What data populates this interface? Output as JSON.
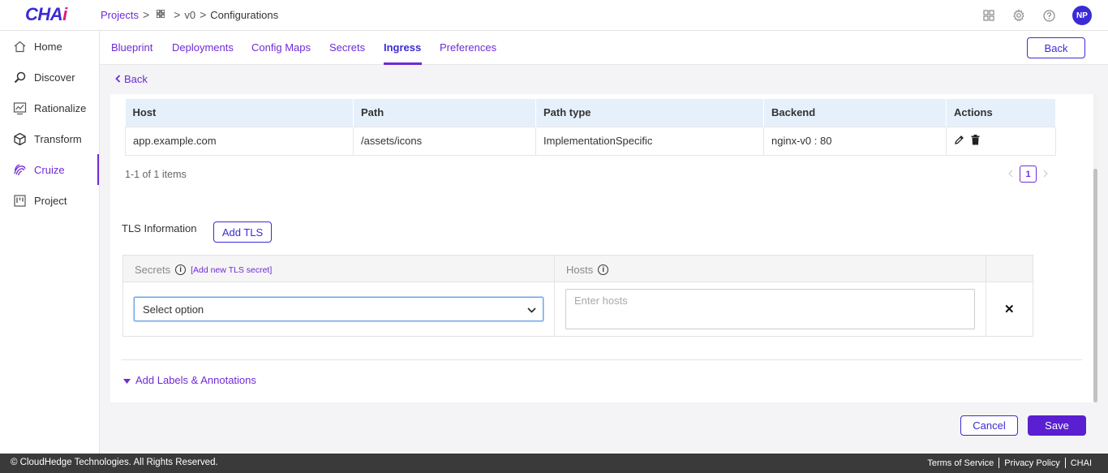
{
  "app": {
    "logo_main": "CHA",
    "logo_accent": "i"
  },
  "breadcrumb": {
    "projects": "Projects",
    "version": "v0",
    "current": "Configurations",
    "separator": ">"
  },
  "topbar": {
    "avatar_initials": "NP"
  },
  "sidebar": {
    "items": [
      {
        "label": "Home",
        "icon": "home-icon"
      },
      {
        "label": "Discover",
        "icon": "discover-icon"
      },
      {
        "label": "Rationalize",
        "icon": "rationalize-icon"
      },
      {
        "label": "Transform",
        "icon": "transform-icon"
      },
      {
        "label": "Cruize",
        "icon": "cruize-icon",
        "active": true
      },
      {
        "label": "Project",
        "icon": "project-icon"
      }
    ]
  },
  "tabs": [
    "Blueprint",
    "Deployments",
    "Config Maps",
    "Secrets",
    "Ingress",
    "Preferences"
  ],
  "active_tab": "Ingress",
  "header": {
    "back_button": "Back"
  },
  "back_link": "Back",
  "ingress_table": {
    "columns": [
      "Host",
      "Path",
      "Path type",
      "Backend",
      "Actions"
    ],
    "rows": [
      {
        "host": "app.example.com",
        "path": "/assets/icons",
        "path_type": "ImplementationSpecific",
        "backend": "nginx-v0 : 80"
      }
    ]
  },
  "pagination": {
    "summary": "1-1 of 1 items",
    "current_page": "1"
  },
  "tls": {
    "title": "TLS Information",
    "add_button": "Add TLS",
    "secrets_header": "Secrets",
    "add_secret_link": "[Add new TLS secret]",
    "hosts_header": "Hosts",
    "info_glyph": "i",
    "select_value": "Select option",
    "hosts_placeholder": "Enter hosts",
    "remove_glyph": "✕"
  },
  "labels_toggle": "Add Labels & Annotations",
  "actions": {
    "cancel": "Cancel",
    "save": "Save"
  },
  "footer": {
    "copyright": "© CloudHedge Technologies. All Rights Reserved.",
    "terms": "Terms of Service",
    "privacy": "Privacy Policy",
    "brand": "CHAI"
  },
  "colors": {
    "accent": "#6f2bd6",
    "brand_blue": "#3b2bd6",
    "save_bg": "#5a1fd1",
    "table_header": "#e6f0fb"
  }
}
